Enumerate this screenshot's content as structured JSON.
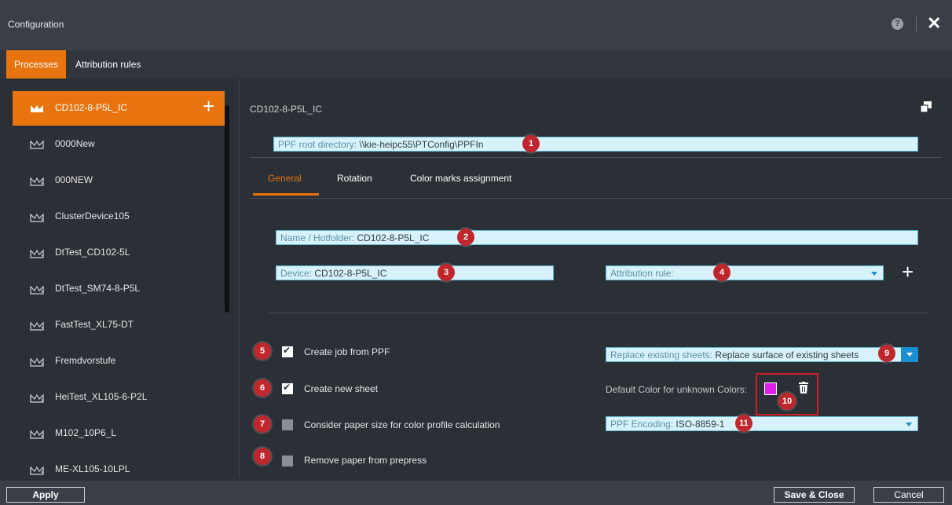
{
  "window": {
    "title": "Configuration"
  },
  "tabs": [
    {
      "label": "Processes",
      "active": true
    },
    {
      "label": "Attribution rules",
      "active": false
    }
  ],
  "sidebar": {
    "items": [
      {
        "label": "CD102-8-P5L_IC",
        "active": true,
        "icon": "device-crown-icon"
      },
      {
        "label": "0000New",
        "icon": "device-icon"
      },
      {
        "label": "000NEW",
        "icon": "device-star-icon"
      },
      {
        "label": "ClusterDevice105",
        "icon": "device-star-icon"
      },
      {
        "label": "DtTest_CD102-5L",
        "icon": "device-star-icon"
      },
      {
        "label": "DtTest_SM74-8-P5L",
        "icon": "device-star-icon"
      },
      {
        "label": "FastTest_XL75-DT",
        "icon": "device-star-icon"
      },
      {
        "label": "Fremdvorstufe",
        "icon": "device-star-icon"
      },
      {
        "label": "HeiTest_XL105-6-P2L",
        "icon": "device-star-icon"
      },
      {
        "label": "M102_10P6_L",
        "icon": "device-star-icon"
      },
      {
        "label": "ME-XL105-10LPL",
        "icon": "device-star-icon"
      }
    ],
    "add_symbol": "+"
  },
  "detail": {
    "title": "CD102-8-P5L_IC",
    "ppf_root": {
      "label": "PPF root directory:",
      "value": "\\\\kie-heipc55\\PTConfig\\PPFIn",
      "badge": "1"
    },
    "subtabs": [
      {
        "label": "General",
        "active": true
      },
      {
        "label": "Rotation"
      },
      {
        "label": "Color marks assignment"
      }
    ],
    "name_hotfolder": {
      "label": "Name / Hotfolder:",
      "value": "CD102-8-P5L_IC",
      "badge": "2"
    },
    "device": {
      "label": "Device:",
      "value": "CD102-8-P5L_IC",
      "badge": "3"
    },
    "attribution_rule": {
      "label": "Attribution rule:",
      "value": "",
      "badge": "4"
    },
    "add_symbol": "+",
    "options": [
      {
        "label": "Create job from PPF",
        "checked": true,
        "badge": "5"
      },
      {
        "label": "Create new sheet",
        "checked": true,
        "badge": "6"
      },
      {
        "label": "Consider paper size for color profile calculation",
        "checked": false,
        "badge": "7"
      },
      {
        "label": "Remove paper from prepress",
        "checked": false,
        "badge": "8"
      }
    ],
    "replace_sheets": {
      "label": "Replace existing sheets:",
      "value": "Replace surface of existing sheets",
      "badge": "9"
    },
    "default_color": {
      "label": "Default Color for unknown Colors:",
      "color": "#e020e6",
      "badge": "10"
    },
    "ppf_encoding": {
      "label": "PPF Encoding:",
      "value": "ISO-8859-1",
      "badge": "11"
    }
  },
  "footer": {
    "apply": "Apply",
    "save_close": "Save & Close",
    "cancel": "Cancel"
  },
  "colors": {
    "accent": "#e8740f",
    "badge": "#c0272d",
    "input_bg": "#d7f2fb"
  }
}
